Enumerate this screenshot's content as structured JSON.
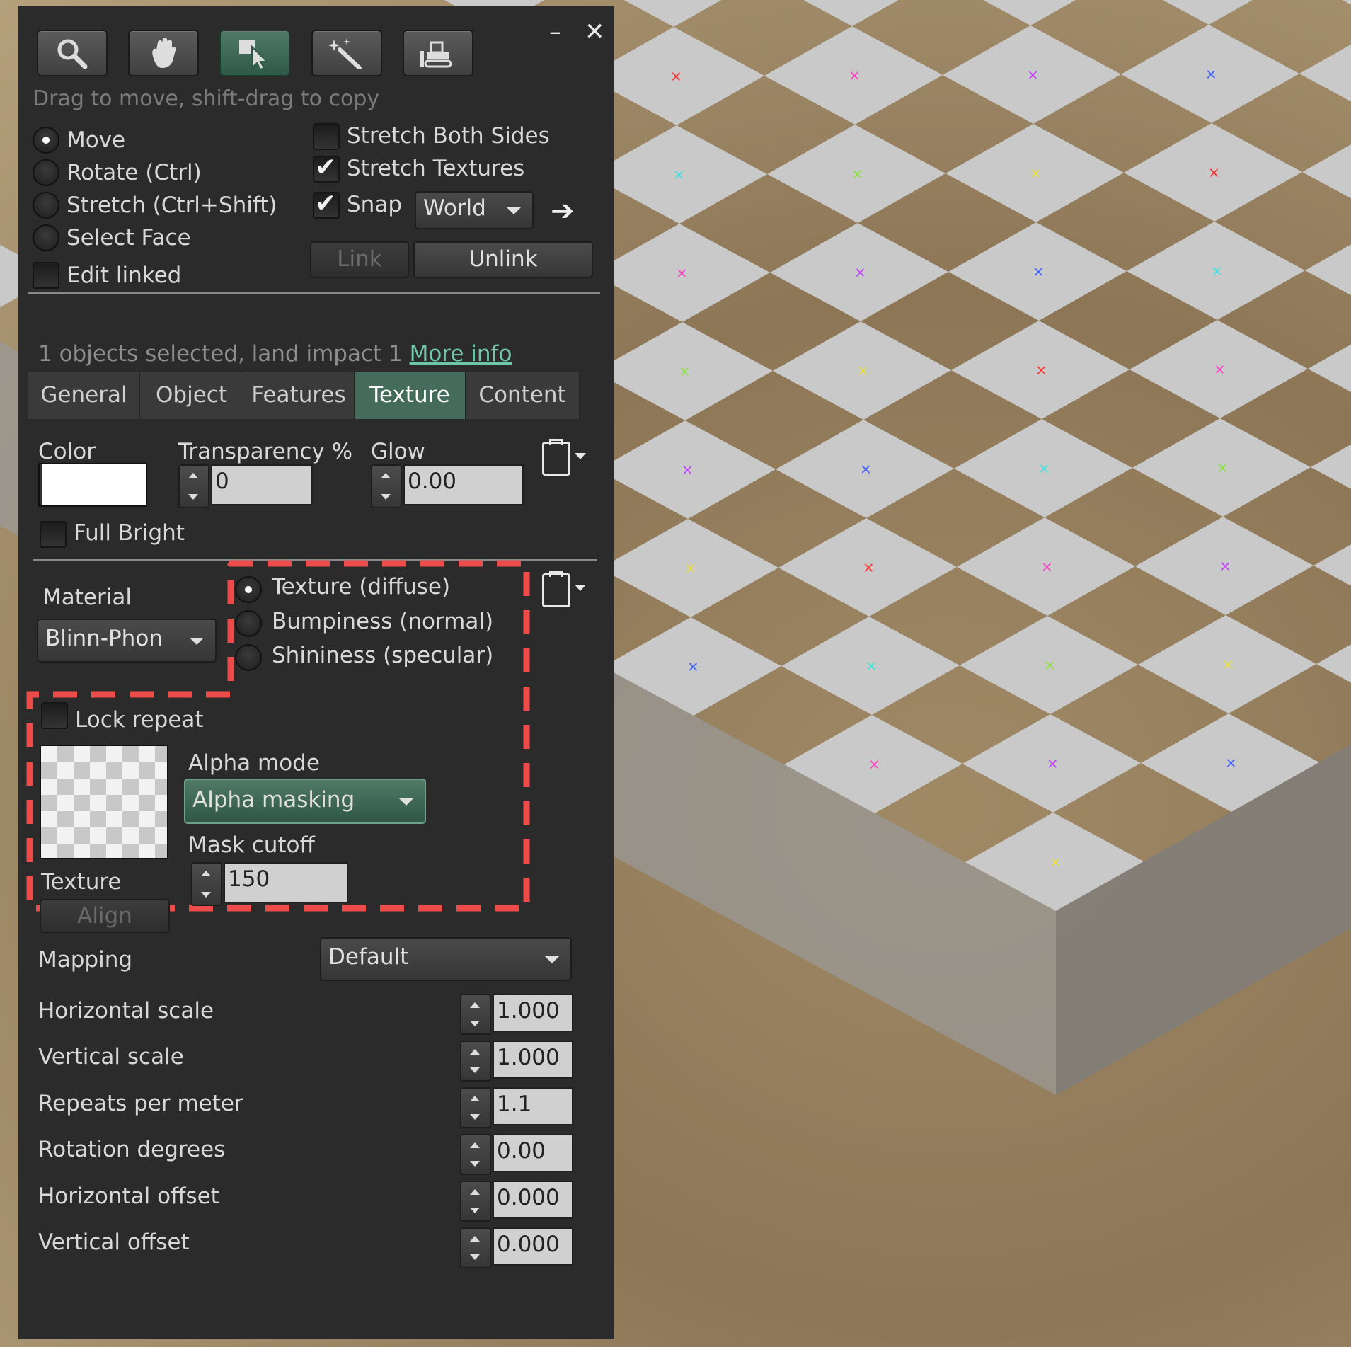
{
  "toolbar": {
    "tools": [
      "zoom-icon",
      "grab-icon",
      "select-icon",
      "create-wand-icon",
      "land-bulldozer-icon"
    ],
    "minimize": "–",
    "close": "✕",
    "hint": "Drag to move, shift-drag to copy"
  },
  "modes": {
    "move": "Move",
    "rotate": "Rotate (Ctrl)",
    "stretch": "Stretch (Ctrl+Shift)",
    "select_face": "Select Face",
    "edit_linked": "Edit linked"
  },
  "options": {
    "stretch_both_sides": "Stretch Both Sides",
    "stretch_textures": "Stretch Textures",
    "snap": "Snap",
    "snap_value": "World",
    "link": "Link",
    "unlink": "Unlink"
  },
  "selection": {
    "summary": "1 objects selected, land impact 1",
    "more_info": "More info"
  },
  "tabs": [
    "General",
    "Object",
    "Features",
    "Texture",
    "Content"
  ],
  "active_tab": "Texture",
  "texture_panel": {
    "color_label": "Color",
    "color_value": "#ffffff",
    "transparency_label": "Transparency %",
    "transparency_value": "0",
    "glow_label": "Glow",
    "glow_value": "0.00",
    "full_bright": "Full Bright",
    "material_label": "Material",
    "material_value": "Blinn-Phon",
    "material_types": [
      "Texture (diffuse)",
      "Bumpiness (normal)",
      "Shininess (specular)"
    ],
    "lock_repeat": "Lock repeat",
    "texture_label": "Texture",
    "align": "Align",
    "alpha_mode_label": "Alpha mode",
    "alpha_mode_value": "Alpha masking",
    "mask_cutoff_label": "Mask cutoff",
    "mask_cutoff_value": "150",
    "mapping_label": "Mapping",
    "mapping_value": "Default",
    "params": [
      {
        "label": "Horizontal scale",
        "value": "1.000"
      },
      {
        "label": "Vertical scale",
        "value": "1.000"
      },
      {
        "label": "Repeats per meter",
        "value": "1.1"
      },
      {
        "label": "Rotation degrees",
        "value": "0.00"
      },
      {
        "label": "Horizontal offset",
        "value": "0.000"
      },
      {
        "label": "Vertical offset",
        "value": "0.000"
      }
    ]
  },
  "colors": {
    "panel_bg": "#2b2b2b",
    "accent": "#456b5c",
    "link": "#6fc6a8",
    "highlight_dash": "#ee4b4b"
  }
}
